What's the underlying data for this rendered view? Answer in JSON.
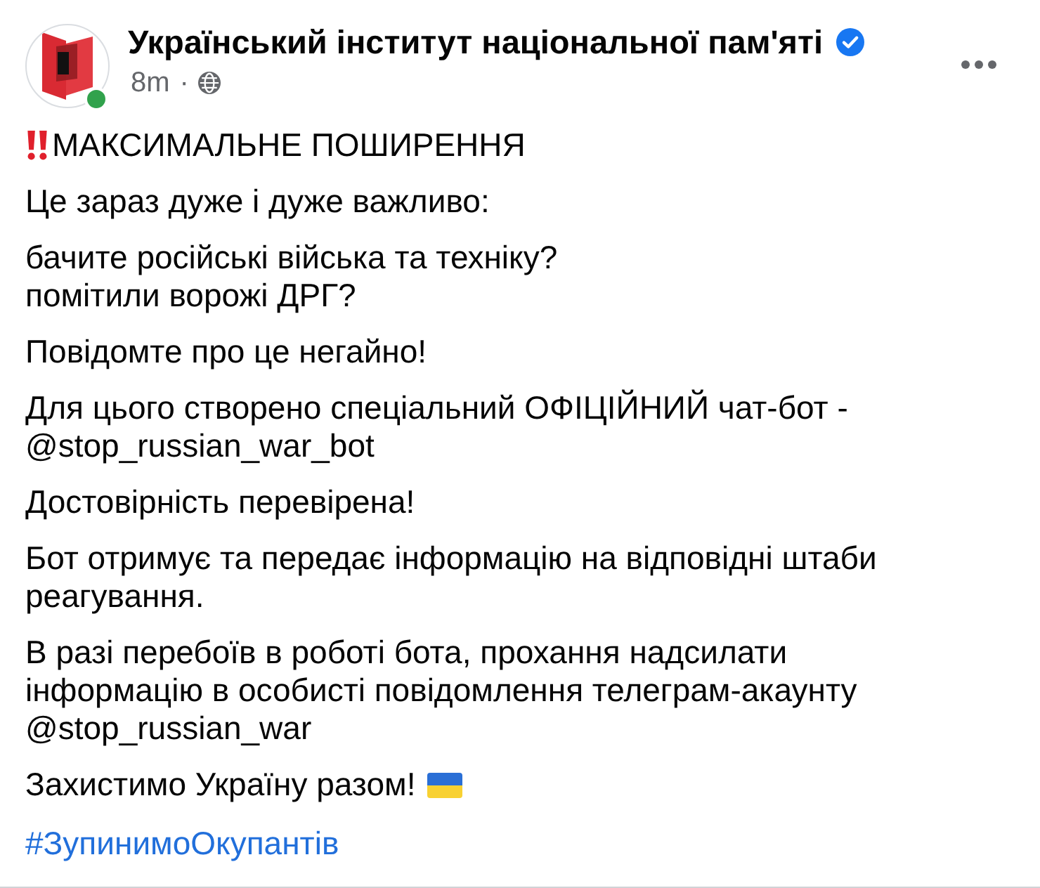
{
  "post": {
    "author": {
      "name": "Український інститут національної пам'яті",
      "verified": true,
      "online": true
    },
    "time": "8m",
    "separator": "·",
    "paragraphs": [
      {
        "kind": "alert",
        "lines": [
          "МАКСИМАЛЬНЕ ПОШИРЕННЯ"
        ]
      },
      {
        "kind": "text",
        "lines": [
          "Це зараз дуже і дуже важливо:"
        ]
      },
      {
        "kind": "text",
        "lines": [
          "бачите російські війська та техніку?",
          "помітили ворожі ДРГ?"
        ]
      },
      {
        "kind": "text",
        "lines": [
          "Повідомте про це негайно!"
        ]
      },
      {
        "kind": "text",
        "lines": [
          "Для цього створено спеціальний ОФІЦІЙНИЙ чат-бот -",
          "@stop_russian_war_bot"
        ]
      },
      {
        "kind": "text",
        "lines": [
          "Достовірність перевірена!"
        ]
      },
      {
        "kind": "text",
        "lines": [
          "Бот отримує та передає інформацію на відповідні штаби",
          "реагування."
        ]
      },
      {
        "kind": "text",
        "lines": [
          "В разі перебоїв в роботі бота, прохання надсилати",
          "інформацію в особисті повідомлення телеграм-акаунту",
          "@stop_russian_war"
        ]
      },
      {
        "kind": "flag",
        "lines": [
          "Захистимо Україну разом!"
        ]
      },
      {
        "kind": "hashtag",
        "lines": [
          "#ЗупинимоОкупантів"
        ]
      }
    ]
  }
}
